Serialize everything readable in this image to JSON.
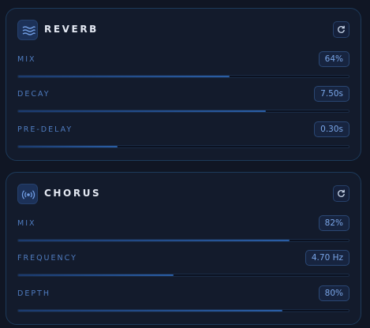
{
  "panels": {
    "reverb": {
      "title": "REVERB",
      "icon": "waves-icon",
      "params": [
        {
          "label": "MIX",
          "value": "64%",
          "level": 0.64
        },
        {
          "label": "DECAY",
          "value": "7.50s",
          "level": 0.75
        },
        {
          "label": "PRE-DELAY",
          "value": "0.30s",
          "level": 0.3
        }
      ]
    },
    "chorus": {
      "title": "CHORUS",
      "icon": "broadcast-icon",
      "params": [
        {
          "label": "MIX",
          "value": "82%",
          "level": 0.82
        },
        {
          "label": "FREQUENCY",
          "value": "4.70 Hz",
          "level": 0.47
        },
        {
          "label": "DEPTH",
          "value": "80%",
          "level": 0.8
        }
      ]
    }
  },
  "colors": {
    "accent": "#2a5ea6",
    "label": "#4f7cc0",
    "value": "#7aa6e8"
  }
}
